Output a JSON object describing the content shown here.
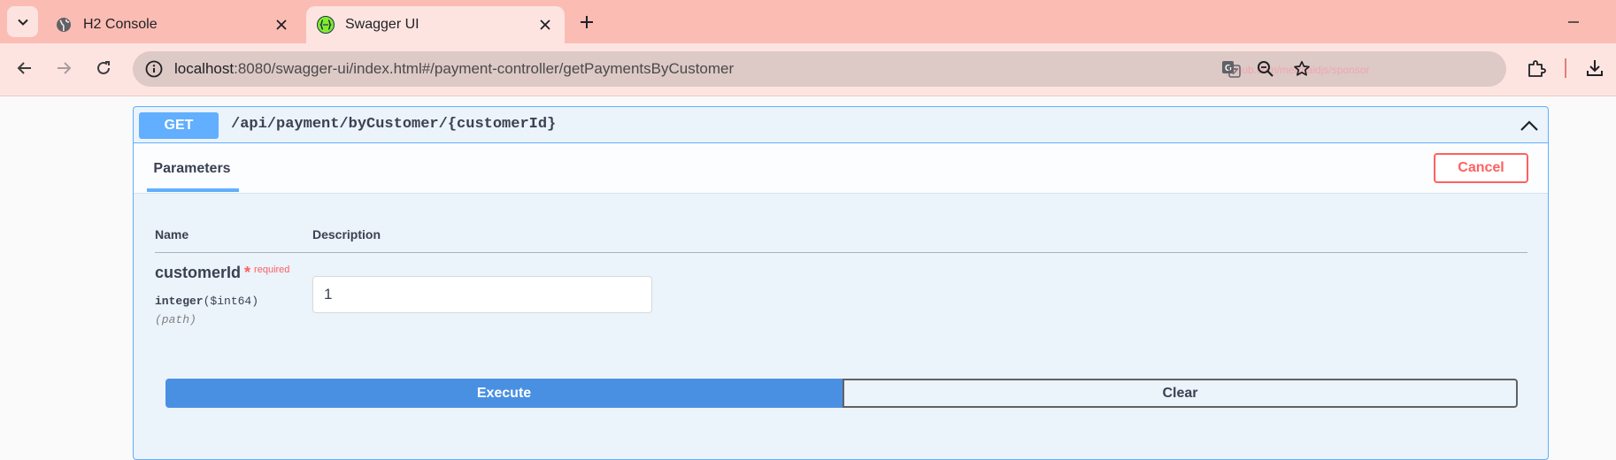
{
  "browser": {
    "tabs": [
      {
        "title": "H2 Console",
        "icon": "globe-icon",
        "active": false
      },
      {
        "title": "Swagger UI",
        "icon": "swagger-icon",
        "active": true
      }
    ],
    "url_host": "localhost",
    "url_rest": ":8080/swagger-ui/index.html#/payment-controller/getPaymentsByCustomer",
    "watermark": "github.com/mermaidjs/sponsor"
  },
  "operation": {
    "method": "GET",
    "path": "/api/payment/byCustomer/{customerId}"
  },
  "parameters": {
    "tab_label": "Parameters",
    "cancel_label": "Cancel",
    "col_name": "Name",
    "col_description": "Description",
    "items": [
      {
        "name": "customerId",
        "star": "*",
        "required_label": "required",
        "type": "integer",
        "format": "($int64)",
        "in": "(path)",
        "value": "1"
      }
    ]
  },
  "actions": {
    "execute_label": "Execute",
    "clear_label": "Clear"
  },
  "colors": {
    "get_accent": "#61affe",
    "execute": "#4990e2",
    "cancel": "#ff6060",
    "tab_strip": "#fbbcb4"
  }
}
